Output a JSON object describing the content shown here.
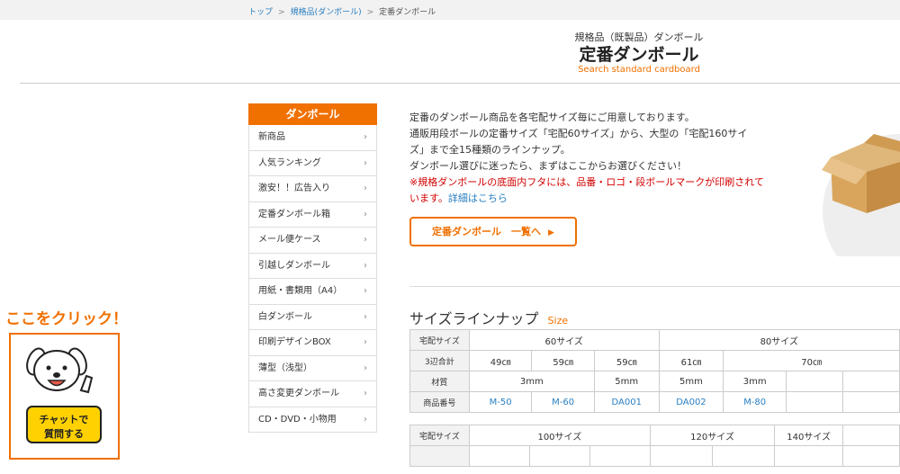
{
  "breadcrumb": {
    "home": "トップ",
    "category": "規格品(ダンボール)",
    "current": "定番ダンボール",
    "sep": ">"
  },
  "header": {
    "subtitle": "規格品（既製品）ダンボール",
    "title": "定番ダンボール",
    "english": "Search standard cardboard"
  },
  "sidebar": {
    "title": "ダンボール",
    "items": [
      "新商品",
      "人気ランキング",
      "激安！！広告入り",
      "定番ダンボール箱",
      "メール便ケース",
      "引越しダンボール",
      "用紙・書類用（A4）",
      "白ダンボール",
      "印刷デザインBOX",
      "薄型（浅型）",
      "高さ変更ダンボール",
      "CD・DVD・小物用"
    ]
  },
  "intro": {
    "line1": "定番のダンボール商品を各宅配サイズ毎にご用意しております。",
    "line2": "通販用段ボールの定番サイズ「宅配60サイズ」から、大型の「宅配160サイ",
    "line3": "ズ」まで全15種類のラインナップ。",
    "line4": "ダンボール選びに迷ったら、まずはここからお選びください！",
    "warn1": "※規格ダンボールの底面内フタには、品番・ロゴ・段ボールマークが印刷されて",
    "warn2": "います。",
    "detail_link": "詳細はこちら"
  },
  "cta": {
    "label": "定番ダンボール　一覧へ",
    "arrow": "▶"
  },
  "lineup": {
    "title": "サイズラインナップ",
    "title_en": "Size"
  },
  "table1": {
    "row1_label": "宅配サイズ",
    "size60": "60サイズ",
    "size80": "80サイズ",
    "row2_label": "3辺合計",
    "sum": [
      "49㎝",
      "59㎝",
      "59㎝",
      "61㎝",
      "70㎝"
    ],
    "row3_label": "材質",
    "mat": [
      "3mm",
      "5mm",
      "5mm",
      "3mm"
    ],
    "row4_label": "商品番号",
    "codes": [
      "M-50",
      "M-60",
      "DA001",
      "DA002",
      "M-80"
    ]
  },
  "table2": {
    "row1_label": "宅配サイズ",
    "sizes": [
      "100サイズ",
      "120サイズ",
      "140サイズ"
    ]
  },
  "chat": {
    "label": "ここをクリック！",
    "bubble_line1": "チャットで",
    "bubble_line2": "質問する"
  }
}
